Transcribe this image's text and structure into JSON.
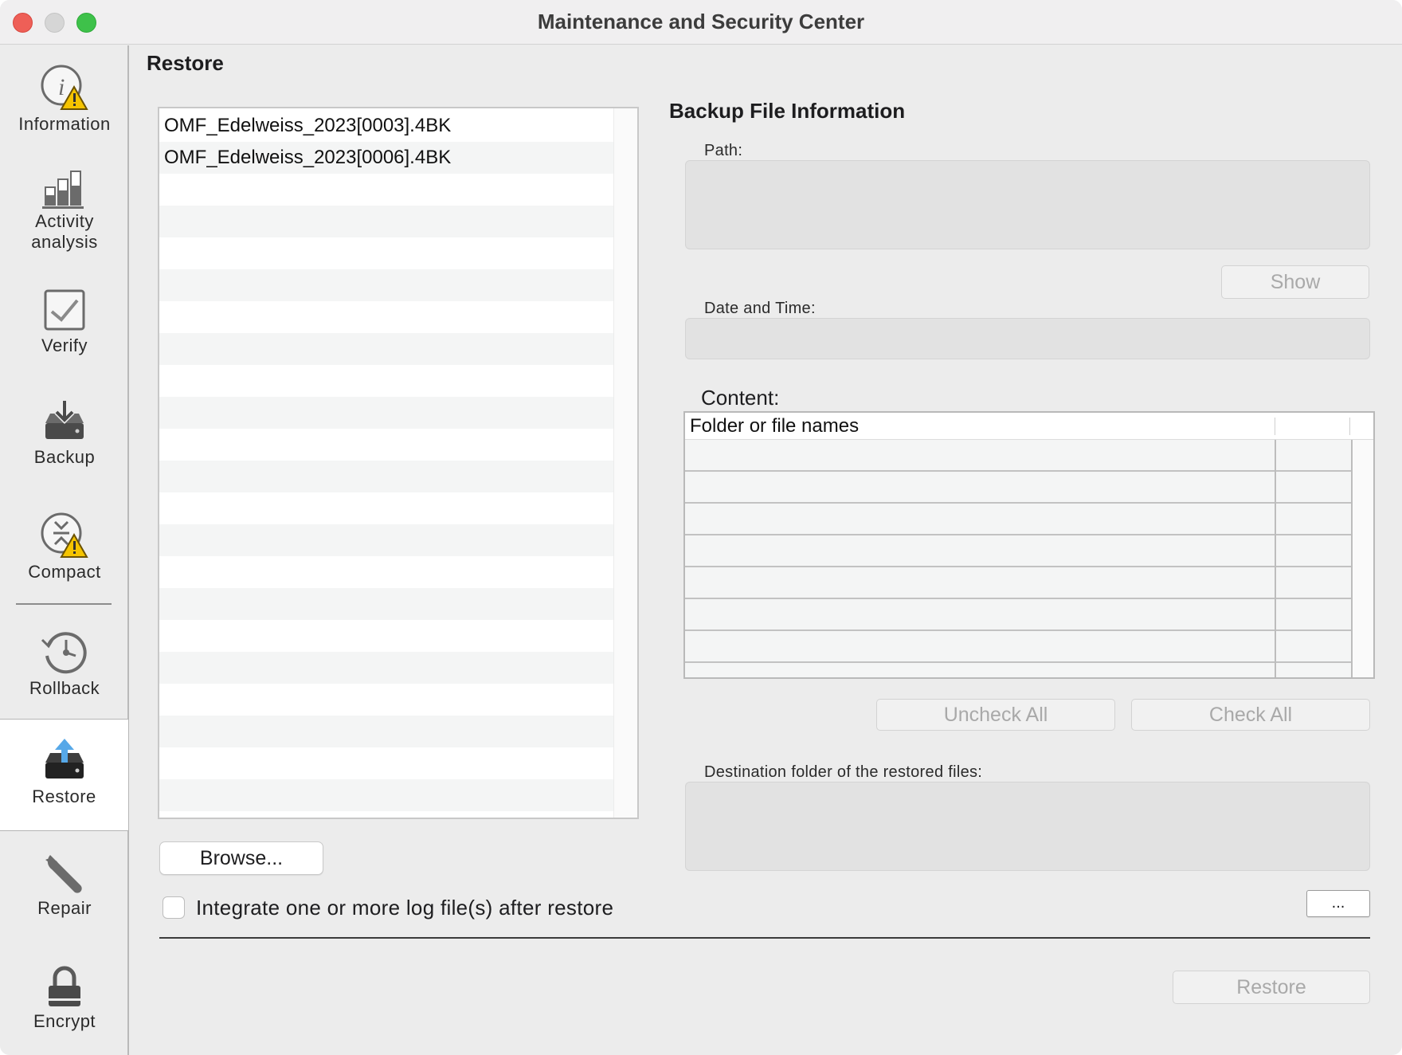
{
  "window": {
    "title": "Maintenance and Security Center"
  },
  "sidebar": {
    "items": [
      {
        "label": "Information",
        "icon": "info-warning-icon"
      },
      {
        "label": "Activity\nanalysis",
        "label_line1": "Activity",
        "label_line2": "analysis",
        "icon": "bar-chart-icon"
      },
      {
        "label": "Verify",
        "icon": "checkbox-icon"
      },
      {
        "label": "Backup",
        "icon": "backup-drive-icon"
      },
      {
        "label": "Compact",
        "icon": "compact-warning-icon"
      },
      {
        "label": "Rollback",
        "icon": "rollback-clock-icon"
      },
      {
        "label": "Restore",
        "icon": "restore-drive-icon",
        "active": true
      },
      {
        "label": "Repair",
        "icon": "wrench-icon"
      },
      {
        "label": "Encrypt",
        "icon": "lock-icon"
      }
    ]
  },
  "main": {
    "section_title": "Restore",
    "backup_files": [
      "OMF_Edelweiss_2023[0003].4BK",
      "OMF_Edelweiss_2023[0006].4BK"
    ],
    "browse_label": "Browse...",
    "integrate_log_label": "Integrate one or more log file(s) after restore",
    "integrate_log_checked": false,
    "restore_label": "Restore"
  },
  "info": {
    "title": "Backup File Information",
    "path_label": "Path:",
    "path_value": "",
    "show_label": "Show",
    "date_label": "Date and Time:",
    "date_value": "",
    "content_label": "Content:",
    "content_header": "Folder or file names",
    "uncheck_all_label": "Uncheck All",
    "check_all_label": "Check All",
    "destination_label": "Destination folder of the restored files:",
    "destination_value": "",
    "ellipsis_label": "..."
  },
  "colors": {
    "accent_blue": "#56a8e8",
    "warning_yellow": "#f5c400",
    "close_red": "#ee5f57",
    "zoom_green": "#3ec14a"
  }
}
